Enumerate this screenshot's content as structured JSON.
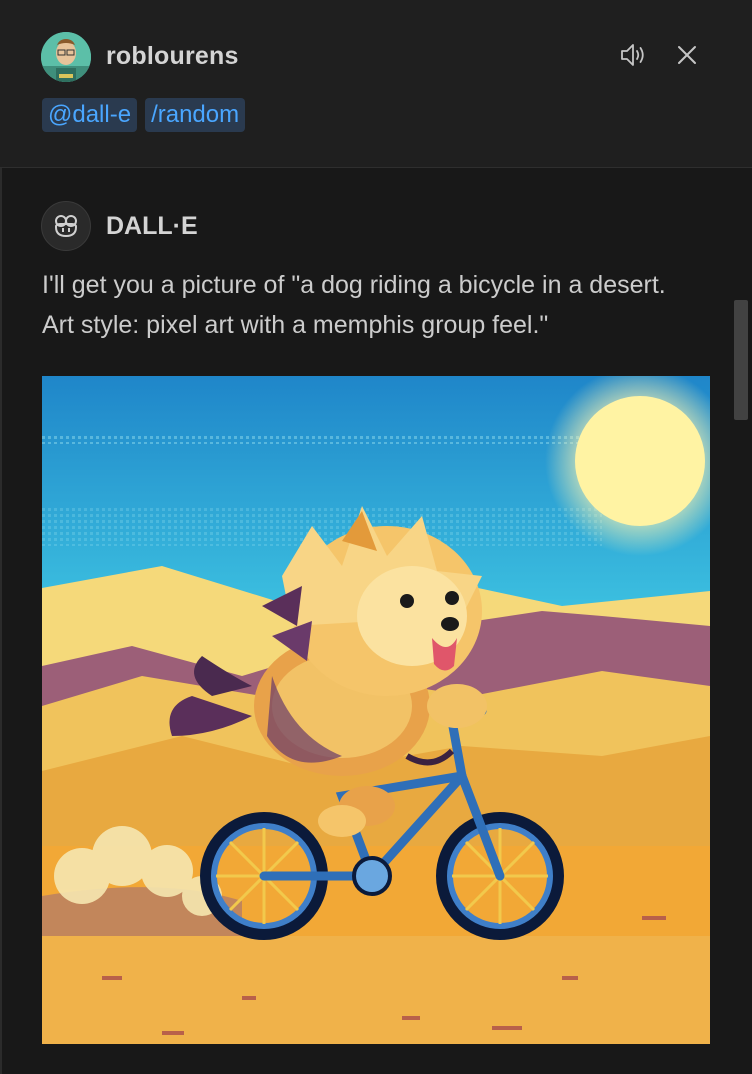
{
  "request": {
    "username": "roblourens",
    "tags": [
      "@dall-e",
      "/random"
    ],
    "read_aloud_icon": "speaker-icon",
    "close_icon": "close-icon"
  },
  "response": {
    "bot_name": "DALL·E",
    "bot_icon": "copilot-icon",
    "message": "I'll get you a picture of \"a dog riding a bicycle in a desert. Art style: pixel art with a memphis group feel.\""
  },
  "colors": {
    "background": "#181818",
    "request_background": "#1f1f1f",
    "tag_background": "#2a3a4f",
    "tag_text": "#4aa6ff"
  }
}
